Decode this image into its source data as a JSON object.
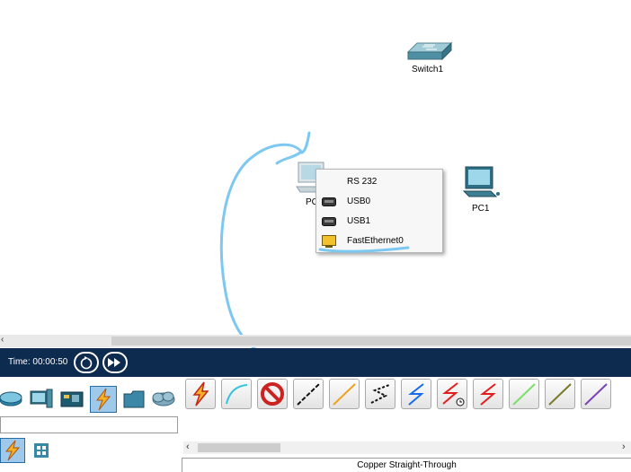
{
  "workspace": {
    "devices": [
      {
        "id": "switch1",
        "label": "Switch1"
      },
      {
        "id": "pc0",
        "label": "PC"
      },
      {
        "id": "pc1",
        "label": "PC1"
      }
    ]
  },
  "port_menu": {
    "items": [
      {
        "label": "RS 232",
        "icon": "none"
      },
      {
        "label": "USB0",
        "icon": "usb-port-icon"
      },
      {
        "label": "USB1",
        "icon": "usb-port-icon"
      },
      {
        "label": "FastEthernet0",
        "icon": "ethernet-port-icon"
      }
    ]
  },
  "timebar": {
    "time_label": "Time: 00:00:50",
    "power_cycle_icon": "power-cycle-icon",
    "fast_forward_icon": "fast-forward-icon"
  },
  "device_categories": [
    "network-devices-icon",
    "end-devices-icon",
    "components-icon",
    "connections-icon",
    "miscellaneous-icon",
    "multiuser-icon"
  ],
  "connections": {
    "types": [
      {
        "name": "automatic",
        "color": "#e53a1e"
      },
      {
        "name": "console",
        "color": "#35c3dc"
      },
      {
        "name": "no-connection",
        "color": "#cc2222"
      },
      {
        "name": "straight-through",
        "color": "#111111"
      },
      {
        "name": "crossover",
        "color": "#f0a020"
      },
      {
        "name": "fiber",
        "color": "#111111"
      },
      {
        "name": "phone",
        "color": "#1a6bea"
      },
      {
        "name": "coaxial-clock",
        "color": "#e21f1f"
      },
      {
        "name": "serial",
        "color": "#e21f1f"
      },
      {
        "name": "octal",
        "color": "#7be06a"
      },
      {
        "name": "iot",
        "color": "#7a7a2a"
      },
      {
        "name": "usb",
        "color": "#7a44b8"
      }
    ],
    "status_text": "Copper Straight-Through"
  },
  "annotation_color": "#7cc8f0"
}
